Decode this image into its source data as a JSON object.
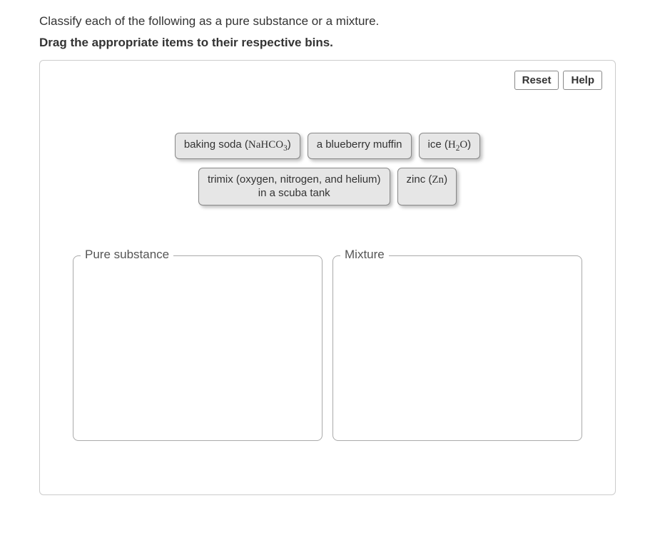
{
  "question": "Classify each of the following as a pure substance or a mixture.",
  "instruction": "Drag the appropriate items to their respective bins.",
  "toolbar": {
    "reset": "Reset",
    "help": "Help"
  },
  "items": {
    "baking_soda_pre": "baking soda (",
    "baking_soda_formula": "NaHCO",
    "baking_soda_sub": "3",
    "baking_soda_post": ")",
    "blueberry": "a blueberry muffin",
    "ice_pre": "ice (",
    "ice_h": "H",
    "ice_sub": "2",
    "ice_o": "O",
    "ice_post": ")",
    "trimix_line1": "trimix (oxygen, nitrogen, and helium)",
    "trimix_line2": "in a scuba tank",
    "zinc_pre": "zinc (",
    "zinc_formula": "Zn",
    "zinc_post": ")"
  },
  "bins": {
    "pure": "Pure substance",
    "mixture": "Mixture"
  }
}
